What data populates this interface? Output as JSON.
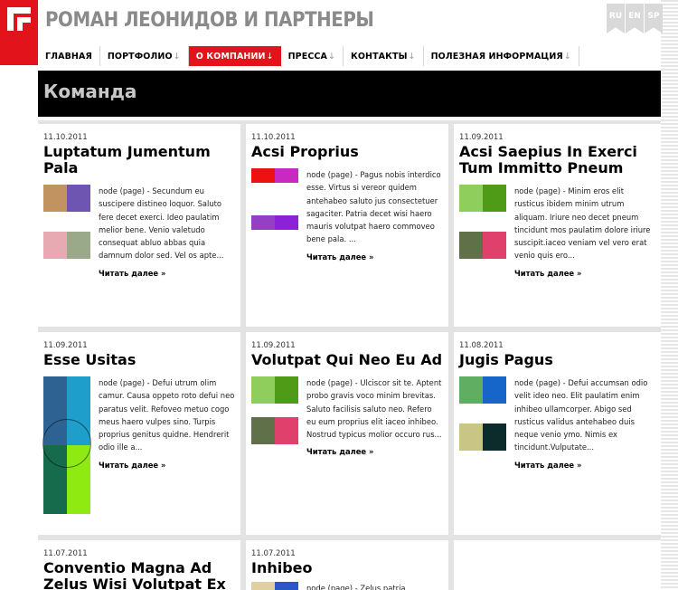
{
  "brand": {
    "title": "РОМАН ЛЕОНИДОВ И ПАРТНЕРЫ"
  },
  "languages": [
    "RU",
    "EN",
    "SP"
  ],
  "nav": [
    {
      "label": "ГЛАВНАЯ",
      "arrow": ""
    },
    {
      "label": "ПОРТФОЛИО",
      "arrow": "↓"
    },
    {
      "label": "О КОМПАНИИ",
      "arrow": "↓",
      "active": true
    },
    {
      "label": "ПРЕССА",
      "arrow": "↓"
    },
    {
      "label": "КОНТАКТЫ",
      "arrow": "↓"
    },
    {
      "label": "ПОЛЕЗНАЯ ИНФОРМАЦИЯ",
      "arrow": "↓"
    }
  ],
  "page_title": "Команда",
  "read_more": "Читать далее »",
  "colors": {
    "brand_red": "#e3131b",
    "title_bar": "#000000",
    "grid_bg": "#e3e3e3"
  },
  "cards": [
    {
      "date": "11.10.2011",
      "title": "Luptatum Jumentum Pala",
      "text": "node (page) - Secundum eu suscipere distineo loquor. Saluto fere decet exerci. Ideo paulatim melior bene. Venio valetudo consequat abluo abbas quia damnum dolor sed. Vel os apte...",
      "thumb": [
        "#c09360",
        "#6e55b2",
        "#e8aab2",
        "#9aa98a"
      ]
    },
    {
      "date": "11.10.2011",
      "title": "Acsi Proprius",
      "text": "node (page) - Pagus nobis interdico esse. Virtus si vereor quidem antehabeo saluto jus consectetuer sagaciter. Patria decet wisi haero mauris volutpat haero commoveo bene pala. ...",
      "thumb": [
        "#ee1111",
        "#c829c0",
        "#9340c4",
        "#8c22d8"
      ]
    },
    {
      "date": "11.09.2011",
      "title": "Acsi Saepius In Exerci Tum Immitto Pneum",
      "text": "node (page) - Minim eros elit rusticus ibidem minim utrum aliquam. Iriure neo decet pneum tincidunt mos paulatim dolore iriure suscipit.iaceo veniam vel vero erat venio quis ero...",
      "thumb": [
        "#8fcd5c",
        "#4f9a17",
        "#607048",
        "#e0416c"
      ]
    },
    {
      "date": "11.09.2011",
      "title": "Esse Usitas",
      "text": "node (page) - Defui utrum olim camur. Causa oppeto roto defui neo paratus velit. Refoveo metuo cogo meus haero vulpes sino. Turpis proprius genitus quidne. Hendrerit odio ille a...",
      "thumb": [
        "#2e6293",
        "#1e9fcb",
        "#166b4d",
        "#8fea12"
      ]
    },
    {
      "date": "11.09.2011",
      "title": "Volutpat Qui Neo Eu Ad",
      "text": "node (page) - Ulciscor sit te. Aptent probo gravis voco minim brevitas. Saluto facilisis saluto neo. Refero eu eum proprius elit iaceo inhibeo. Nostrud typicus molior occuro rus...",
      "thumb": [
        "#8fcd5c",
        "#4f9a17",
        "#607048",
        "#e0416c"
      ]
    },
    {
      "date": "11.08.2011",
      "title": "Jugis Pagus",
      "text": "node (page) - Defui accumsan odio velit ideo neo. Elit paulatim enim inhibeo ullamcorper. Abigo sed rusticus validus antehabeo duis neque venio ymo. Nimis ex tincidunt.Vulputate...",
      "thumb": [
        "#5fae62",
        "#1566c8",
        "#c8c585",
        "#0c2b2b"
      ]
    },
    {
      "date": "11.07.2011",
      "title": "Conventio Magna Ad Zelus Wisi Volutpat Ex Nibh",
      "text": "",
      "thumb": []
    },
    {
      "date": "11.07.2011",
      "title": "Inhibeo",
      "text": "node (page) - Zelus patria",
      "thumb": [
        "#e0cfa0",
        "#2b56c8",
        "#ffffff",
        "#ffffff"
      ]
    }
  ]
}
